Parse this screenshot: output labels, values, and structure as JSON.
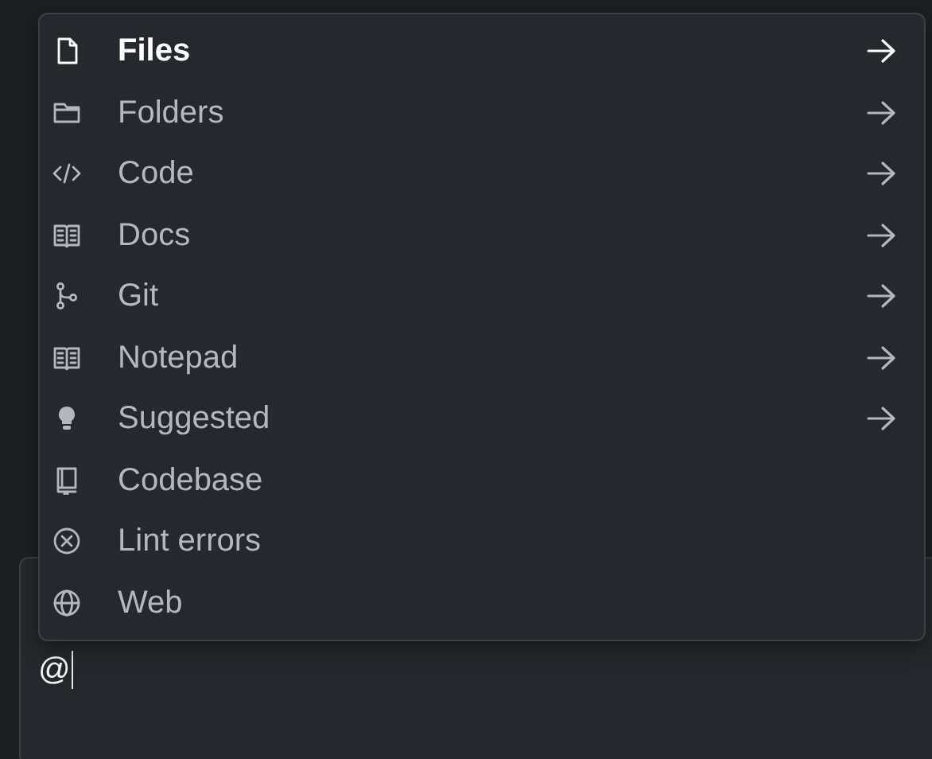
{
  "menu": {
    "items": [
      {
        "label": "Files",
        "selected": true,
        "submenu": true
      },
      {
        "label": "Folders",
        "selected": false,
        "submenu": true
      },
      {
        "label": "Code",
        "selected": false,
        "submenu": true
      },
      {
        "label": "Docs",
        "selected": false,
        "submenu": true
      },
      {
        "label": "Git",
        "selected": false,
        "submenu": true
      },
      {
        "label": "Notepad",
        "selected": false,
        "submenu": true
      },
      {
        "label": "Suggested",
        "selected": false,
        "submenu": true
      },
      {
        "label": "Codebase",
        "selected": false,
        "submenu": false
      },
      {
        "label": "Lint errors",
        "selected": false,
        "submenu": false
      },
      {
        "label": "Web",
        "selected": false,
        "submenu": false
      }
    ]
  },
  "input": {
    "value": "@"
  }
}
